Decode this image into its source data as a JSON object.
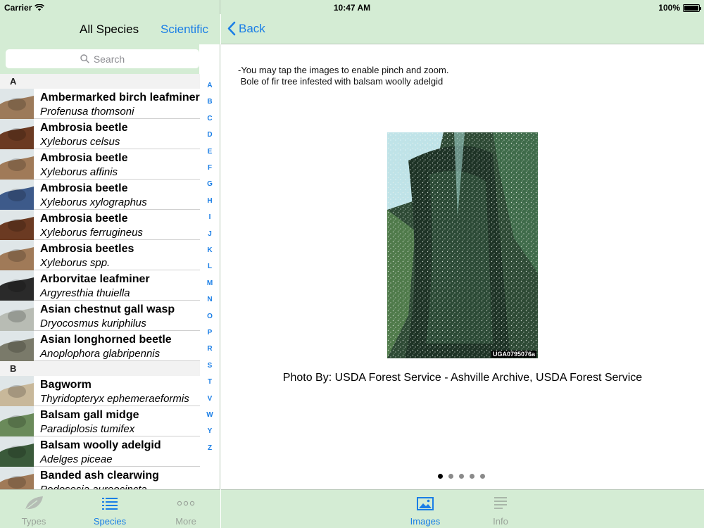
{
  "status_bar": {
    "carrier": "Carrier",
    "time": "10:47 AM",
    "battery": "100%",
    "battery_level": 1.0
  },
  "master": {
    "segments": {
      "all": "All Species",
      "scientific": "Scientific"
    },
    "search": {
      "placeholder": "Search"
    },
    "sections": [
      {
        "letter": "A",
        "items": [
          {
            "common": "Ambermarked birch leafminer",
            "scientific": "Profenusa thomsoni",
            "thumb_color": "#9c7a5a"
          },
          {
            "common": "Ambrosia beetle",
            "scientific": "Xyleborus celsus",
            "thumb_color": "#6b3a22"
          },
          {
            "common": "Ambrosia beetle",
            "scientific": "Xyleborus affinis",
            "thumb_color": "#a07a58"
          },
          {
            "common": "Ambrosia beetle",
            "scientific": "Xyleborus xylographus",
            "thumb_color": "#3d5a8a"
          },
          {
            "common": "Ambrosia beetle",
            "scientific": "Xyleborus ferrugineus",
            "thumb_color": "#6b3a22"
          },
          {
            "common": "Ambrosia beetles",
            "scientific": "Xyleborus spp.",
            "thumb_color": "#a07a58"
          },
          {
            "common": "Arborvitae leafminer",
            "scientific": "Argyresthia thuiella",
            "thumb_color": "#2a2a2a"
          },
          {
            "common": "Asian chestnut gall wasp",
            "scientific": "Dryocosmus kuriphilus",
            "thumb_color": "#b8bcb4"
          },
          {
            "common": "Asian longhorned beetle",
            "scientific": "Anoplophora glabripennis",
            "thumb_color": "#7a7a6a"
          }
        ]
      },
      {
        "letter": "B",
        "items": [
          {
            "common": "Bagworm",
            "scientific": "Thyridopteryx ephemeraeformis",
            "thumb_color": "#c8b89a"
          },
          {
            "common": "Balsam gall midge",
            "scientific": "Paradiplosis tumifex",
            "thumb_color": "#6a8a5a"
          },
          {
            "common": "Balsam woolly adelgid",
            "scientific": "Adelges piceae",
            "thumb_color": "#3a5a3a"
          },
          {
            "common": "Banded ash clearwing",
            "scientific": "Podosesia aureocincta",
            "thumb_color": "#a07a58"
          }
        ]
      }
    ],
    "index_letters": [
      "A",
      "B",
      "C",
      "D",
      "E",
      "F",
      "G",
      "H",
      "I",
      "J",
      "K",
      "L",
      "M",
      "N",
      "O",
      "P",
      "R",
      "S",
      "T",
      "V",
      "W",
      "Y",
      "Z"
    ],
    "tabs": [
      {
        "label": "Types",
        "icon": "leaf-icon",
        "active": false
      },
      {
        "label": "Species",
        "icon": "list-icon",
        "active": true
      },
      {
        "label": "More",
        "icon": "more-icon",
        "active": false
      }
    ]
  },
  "detail": {
    "back_label": "Back",
    "note_lines": [
      "-You may tap the images to enable pinch and zoom.",
      " Bole of fir tree infested with balsam woolly adelgid"
    ],
    "photo_tag": "UGA0795076a",
    "credit": "Photo By: USDA Forest Service - Ashville Archive, USDA Forest Service",
    "page_count": 5,
    "current_page": 1,
    "tabs": [
      {
        "label": "Images",
        "icon": "image-icon",
        "active": true
      },
      {
        "label": "Info",
        "icon": "text-lines-icon",
        "active": false
      }
    ]
  },
  "colors": {
    "bar_bg": "#d4ecd4",
    "accent": "#1a7ee6",
    "tab_inactive": "#9aa39a"
  }
}
